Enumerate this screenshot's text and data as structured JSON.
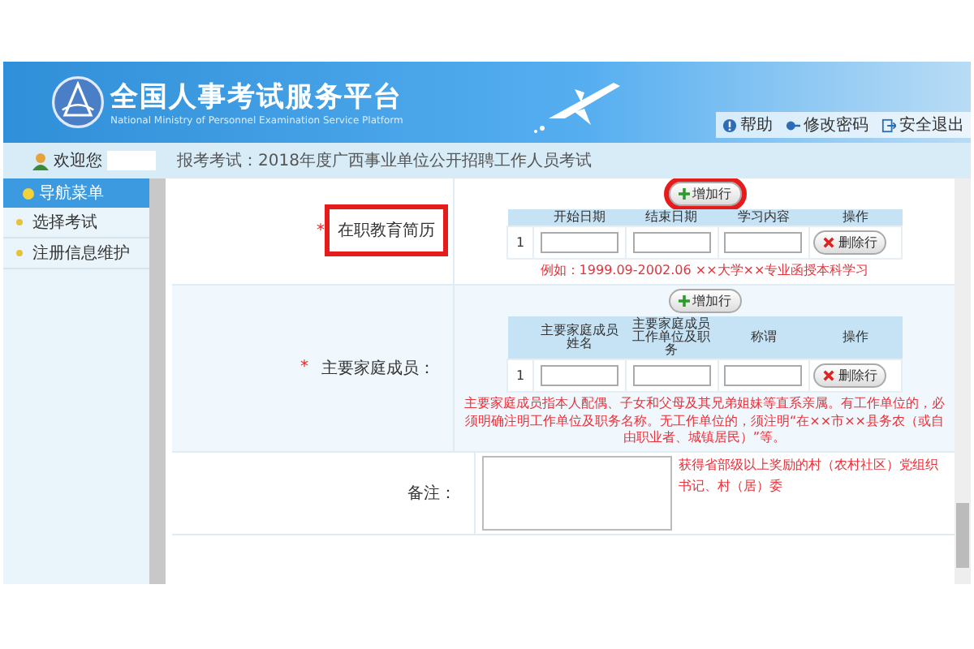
{
  "header": {
    "title": "全国人事考试服务平台",
    "subtitle": "National Ministry of Personnel Examination Service Platform",
    "links": [
      {
        "label": "帮助"
      },
      {
        "label": "修改密码"
      },
      {
        "label": "安全退出"
      }
    ]
  },
  "info_bar": {
    "welcome": "欢迎您",
    "exam": "报考考试：2018年度广西事业单位公开招聘工作人员考试"
  },
  "sidebar": {
    "title": "导航菜单",
    "items": [
      {
        "label": "选择考试"
      },
      {
        "label": "注册信息维护"
      }
    ]
  },
  "sections": [
    {
      "kind": "table",
      "label": "在职教育简历",
      "required_mark": "*",
      "label_highlighted": true,
      "add_button": "增加行",
      "add_highlighted": true,
      "columns": [
        "开始日期",
        "结束日期",
        "学习内容",
        "操作"
      ],
      "rows": [
        {
          "index": "1",
          "delete_button": "删除行"
        }
      ],
      "hint": "例如：1999.09-2002.06 ××大学××专业函授本科学习"
    },
    {
      "kind": "table",
      "label": "主要家庭成员：",
      "required_mark": "*",
      "label_highlighted": false,
      "add_button": "增加行",
      "add_highlighted": false,
      "columns": [
        "主要家庭成员姓名",
        "主要家庭成员工作单位及职务",
        "称谓",
        "操作"
      ],
      "rows": [
        {
          "index": "1",
          "delete_button": "删除行"
        }
      ],
      "hint": "主要家庭成员指本人配偶、子女和父母及其兄弟姐妹等直系亲属。有工作单位的，必须明确注明工作单位及职务名称。无工作单位的，须注明“在××市××县务农（或自由职业者、城镇居民）”等。"
    },
    {
      "kind": "textarea",
      "label": "备注：",
      "label_highlighted": false,
      "side_note": "获得省部级以上奖励的村（农村社区）党组织书记、村（居）委"
    }
  ]
}
